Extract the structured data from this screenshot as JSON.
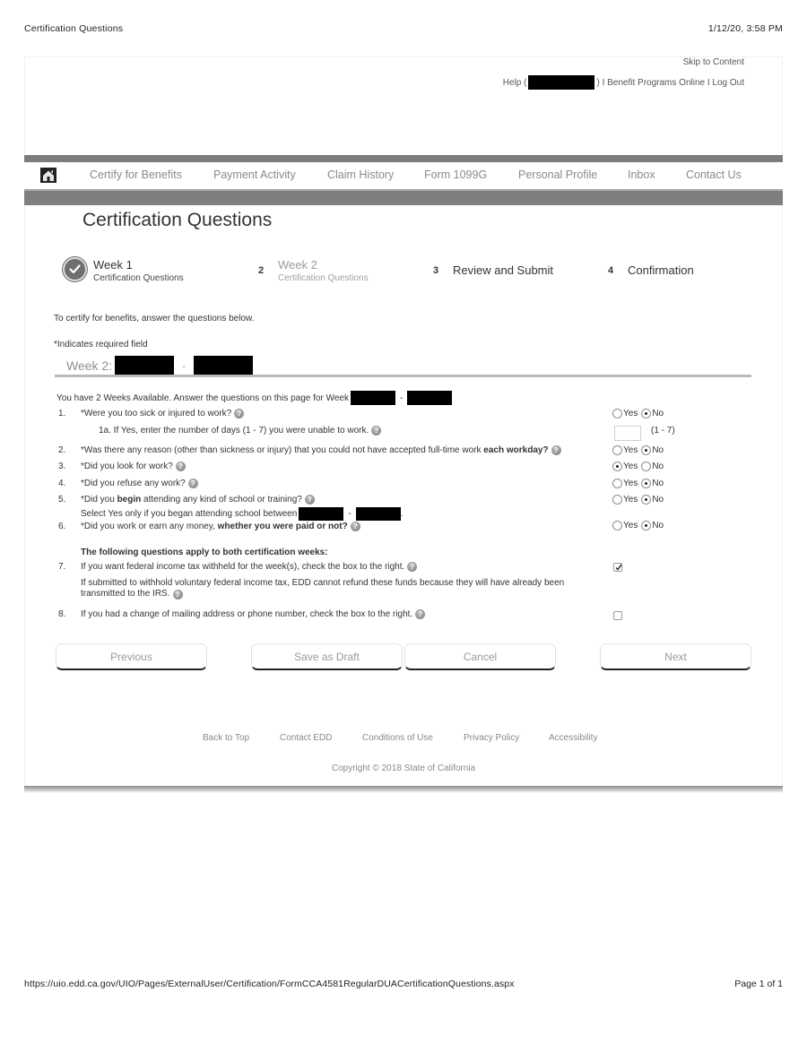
{
  "print_header": {
    "title": "Certification Questions",
    "datetime": "1/12/20, 3:58 PM"
  },
  "print_footer": {
    "url": "https://uio.edd.ca.gov/UIO/Pages/ExternalUser/Certification/FormCCA4581RegularDUACertificationQuestions.aspx",
    "page": "Page 1 of 1"
  },
  "utility": {
    "skip": "Skip to Content",
    "help_prefix": "Help (",
    "help_suffix": ") I Benefit Programs Online I Log Out"
  },
  "nav": {
    "home_icon": "home-icon",
    "items": [
      "Certify for Benefits",
      "Payment Activity",
      "Claim History",
      "Form 1099G",
      "Personal Profile",
      "Inbox",
      "Contact Us"
    ]
  },
  "page_title": "Certification Questions",
  "steps": [
    {
      "number": "",
      "title": "Week 1",
      "subtitle": "Certification Questions",
      "status": "complete"
    },
    {
      "number": "2",
      "title": "Week 2",
      "subtitle": "Certification Questions",
      "status": "current"
    },
    {
      "number": "3",
      "title": "Review and Submit",
      "subtitle": "",
      "status": "pending"
    },
    {
      "number": "4",
      "title": "Confirmation",
      "subtitle": "",
      "status": "pending"
    }
  ],
  "intro": "To certify for benefits, answer the questions below.",
  "required_note": "*Indicates required field",
  "week_label": "Week 2:",
  "date_separator": "-",
  "available_text": "You have 2 Weeks Available. Answer the questions on this page for Week",
  "questions": [
    {
      "num": "1.",
      "text": "*Were you too sick or injured to work?",
      "answer": "No"
    },
    {
      "num": "",
      "text": "1a. If Yes, enter the number of days (1 - 7) you were unable to work.",
      "value": "",
      "hint": "(1 - 7)"
    },
    {
      "num": "2.",
      "text": "*Was there any reason (other than sickness or injury) that you could not have accepted full-time work ",
      "bold": "each workday?",
      "answer": "No"
    },
    {
      "num": "3.",
      "text": "*Did you look for work?",
      "answer": "Yes"
    },
    {
      "num": "4.",
      "text": "*Did you refuse any work?",
      "answer": "No"
    },
    {
      "num": "5.",
      "text_a": "*Did you ",
      "bold": "begin",
      "text_b": " attending any kind of school or training?",
      "sub": "Select Yes only if you began attending school between",
      "answer": "No"
    },
    {
      "num": "6.",
      "text": "*Did you work or earn any money, ",
      "bold": "whether you were paid or not?",
      "answer": "No"
    }
  ],
  "both_weeks_heading": "The following questions apply to both certification weeks:",
  "q7": {
    "num": "7.",
    "text": "If you want federal income tax withheld for the week(s), check the box to the right.",
    "checked": true,
    "note_line1": "If submitted to withhold voluntary federal income tax, EDD cannot refund these funds because they will have already been",
    "note_line2": "transmitted to the IRS."
  },
  "q8": {
    "num": "8.",
    "text": "If you had a change of mailing address or phone number, check the box to the right.",
    "checked": false
  },
  "radio_labels": {
    "yes": "Yes",
    "no": "No"
  },
  "buttons": {
    "previous": "Previous",
    "save_draft": "Save as Draft",
    "cancel": "Cancel",
    "next": "Next"
  },
  "footer": {
    "links": [
      "Back to Top",
      "Contact EDD",
      "Conditions of Use",
      "Privacy Policy",
      "Accessibility"
    ],
    "copyright": "Copyright © 2018 State of California"
  }
}
